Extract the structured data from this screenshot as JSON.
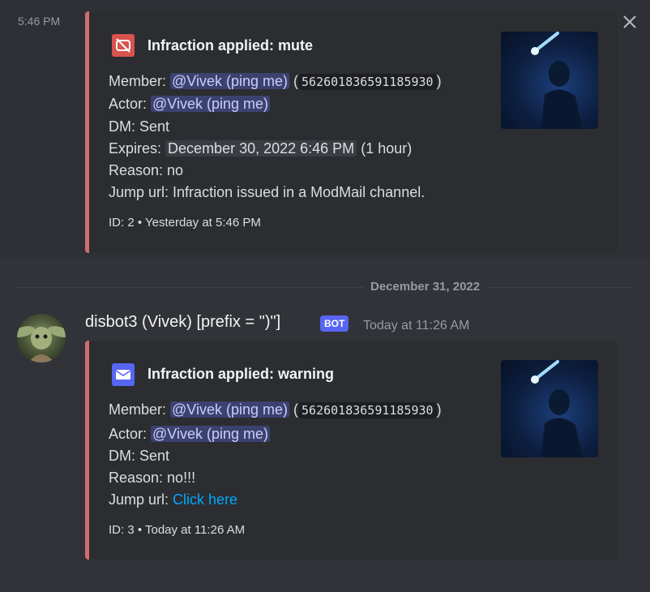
{
  "colors": {
    "background": "#313338",
    "embed_bg": "#2b2d31",
    "embed_accent": "#d26d6d",
    "mention_bg": "#3c4270",
    "link": "#00a8fc",
    "bot_badge": "#5865f2"
  },
  "messages": [
    {
      "timestamp_left": "5:46 PM",
      "embed": {
        "icon": "mute-icon",
        "title": "Infraction applied: mute",
        "member_label": "Member:",
        "member_mention": "@Vivek (ping me)",
        "member_id": "562601836591185930",
        "actor_label": "Actor:",
        "actor_mention": "@Vivek (ping me)",
        "dm": "DM: Sent",
        "expires_label": "Expires:",
        "expires_value": "December 30, 2022 6:46 PM",
        "expires_duration": "(1 hour)",
        "reason": "Reason: no",
        "jump_label": "Jump url:",
        "jump_value": "Infraction issued in a ModMail channel.",
        "footer": "ID: 2 • Yesterday at 5:46 PM"
      }
    },
    {
      "author": "disbot3 (Vivek) [prefix = \")\"]",
      "badge": "BOT",
      "time": "Today at 11:26 AM",
      "embed": {
        "icon": "mail-icon",
        "title": "Infraction applied: warning",
        "member_label": "Member:",
        "member_mention": "@Vivek (ping me)",
        "member_id": "562601836591185930",
        "actor_label": "Actor:",
        "actor_mention": "@Vivek (ping me)",
        "dm": "DM: Sent",
        "reason": "Reason: no!!!",
        "jump_label": "Jump url:",
        "jump_link": "Click here",
        "footer": "ID: 3 • Today at 11:26 AM"
      }
    }
  ],
  "date_divider": "December 31, 2022"
}
